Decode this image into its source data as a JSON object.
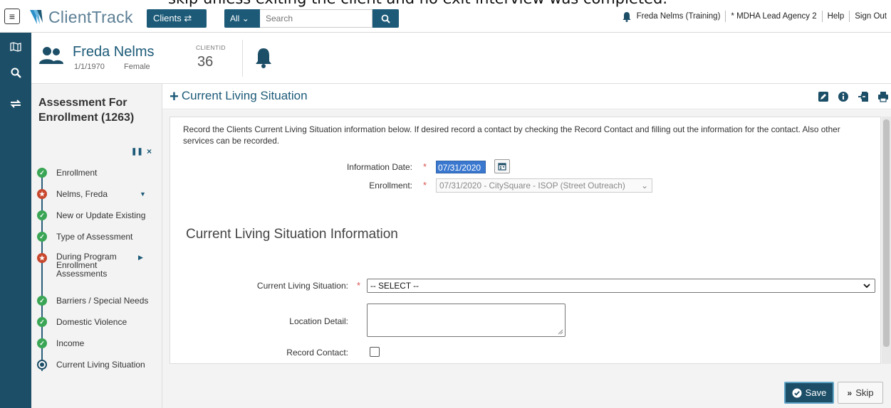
{
  "overlay": {
    "text": "skip unless exiting the client and no exit interview was completed."
  },
  "topbar": {
    "menu_glyph": "≡",
    "logo_text": "ClientTrack",
    "clients_label": "Clients ⇄",
    "search_scope": "All",
    "search_placeholder": "Search",
    "user": "Freda Nelms (Training)",
    "agency": "* MDHA Lead Agency 2",
    "help": "Help",
    "signout": "Sign Out"
  },
  "client": {
    "name": "Freda Nelms",
    "dob": "1/1/1970",
    "gender": "Female",
    "id_label": "CLIENTID",
    "id_value": "36"
  },
  "sidebar": {
    "title": "Assessment For Enrollment (1263)",
    "pause_glyph": "❚❚",
    "close_glyph": "×",
    "steps": [
      {
        "label": "Enrollment",
        "status": "done"
      },
      {
        "label": "Nelms, Freda",
        "status": "warn"
      },
      {
        "label": "New or Update Existing",
        "status": "done"
      },
      {
        "label": "Type of Assessment",
        "status": "done"
      },
      {
        "label": "During Program Enrollment Assessments",
        "status": "warn"
      },
      {
        "label": "Barriers / Special Needs",
        "status": "done"
      },
      {
        "label": "Domestic Violence",
        "status": "done"
      },
      {
        "label": "Income",
        "status": "done"
      },
      {
        "label": "Current Living Situation",
        "status": "current"
      }
    ]
  },
  "main": {
    "title": "Current Living Situation",
    "intro": "Record the Clients Current Living Situation information below.  If desired record a contact by checking the Record Contact and filling out the information for the contact. Also other services can be recorded.",
    "info_date_label": "Information Date:",
    "info_date_value": "07/31/2020",
    "enrollment_label": "Enrollment:",
    "enrollment_value": "07/31/2020 - CitySquare - ISOP (Street Outreach)",
    "section_heading": "Current Living Situation Information",
    "cls_label": "Current Living Situation:",
    "cls_value": "-- SELECT --",
    "location_label": "Location Detail:",
    "record_contact_label": "Record Contact:",
    "required_mark": "*"
  },
  "actions": {
    "save": "Save",
    "skip": "Skip"
  },
  "colors": {
    "brand": "#1c4e67",
    "accent": "#1c5a78",
    "done": "#3aa655",
    "warn": "#c8472d",
    "required": "#d9534f"
  }
}
